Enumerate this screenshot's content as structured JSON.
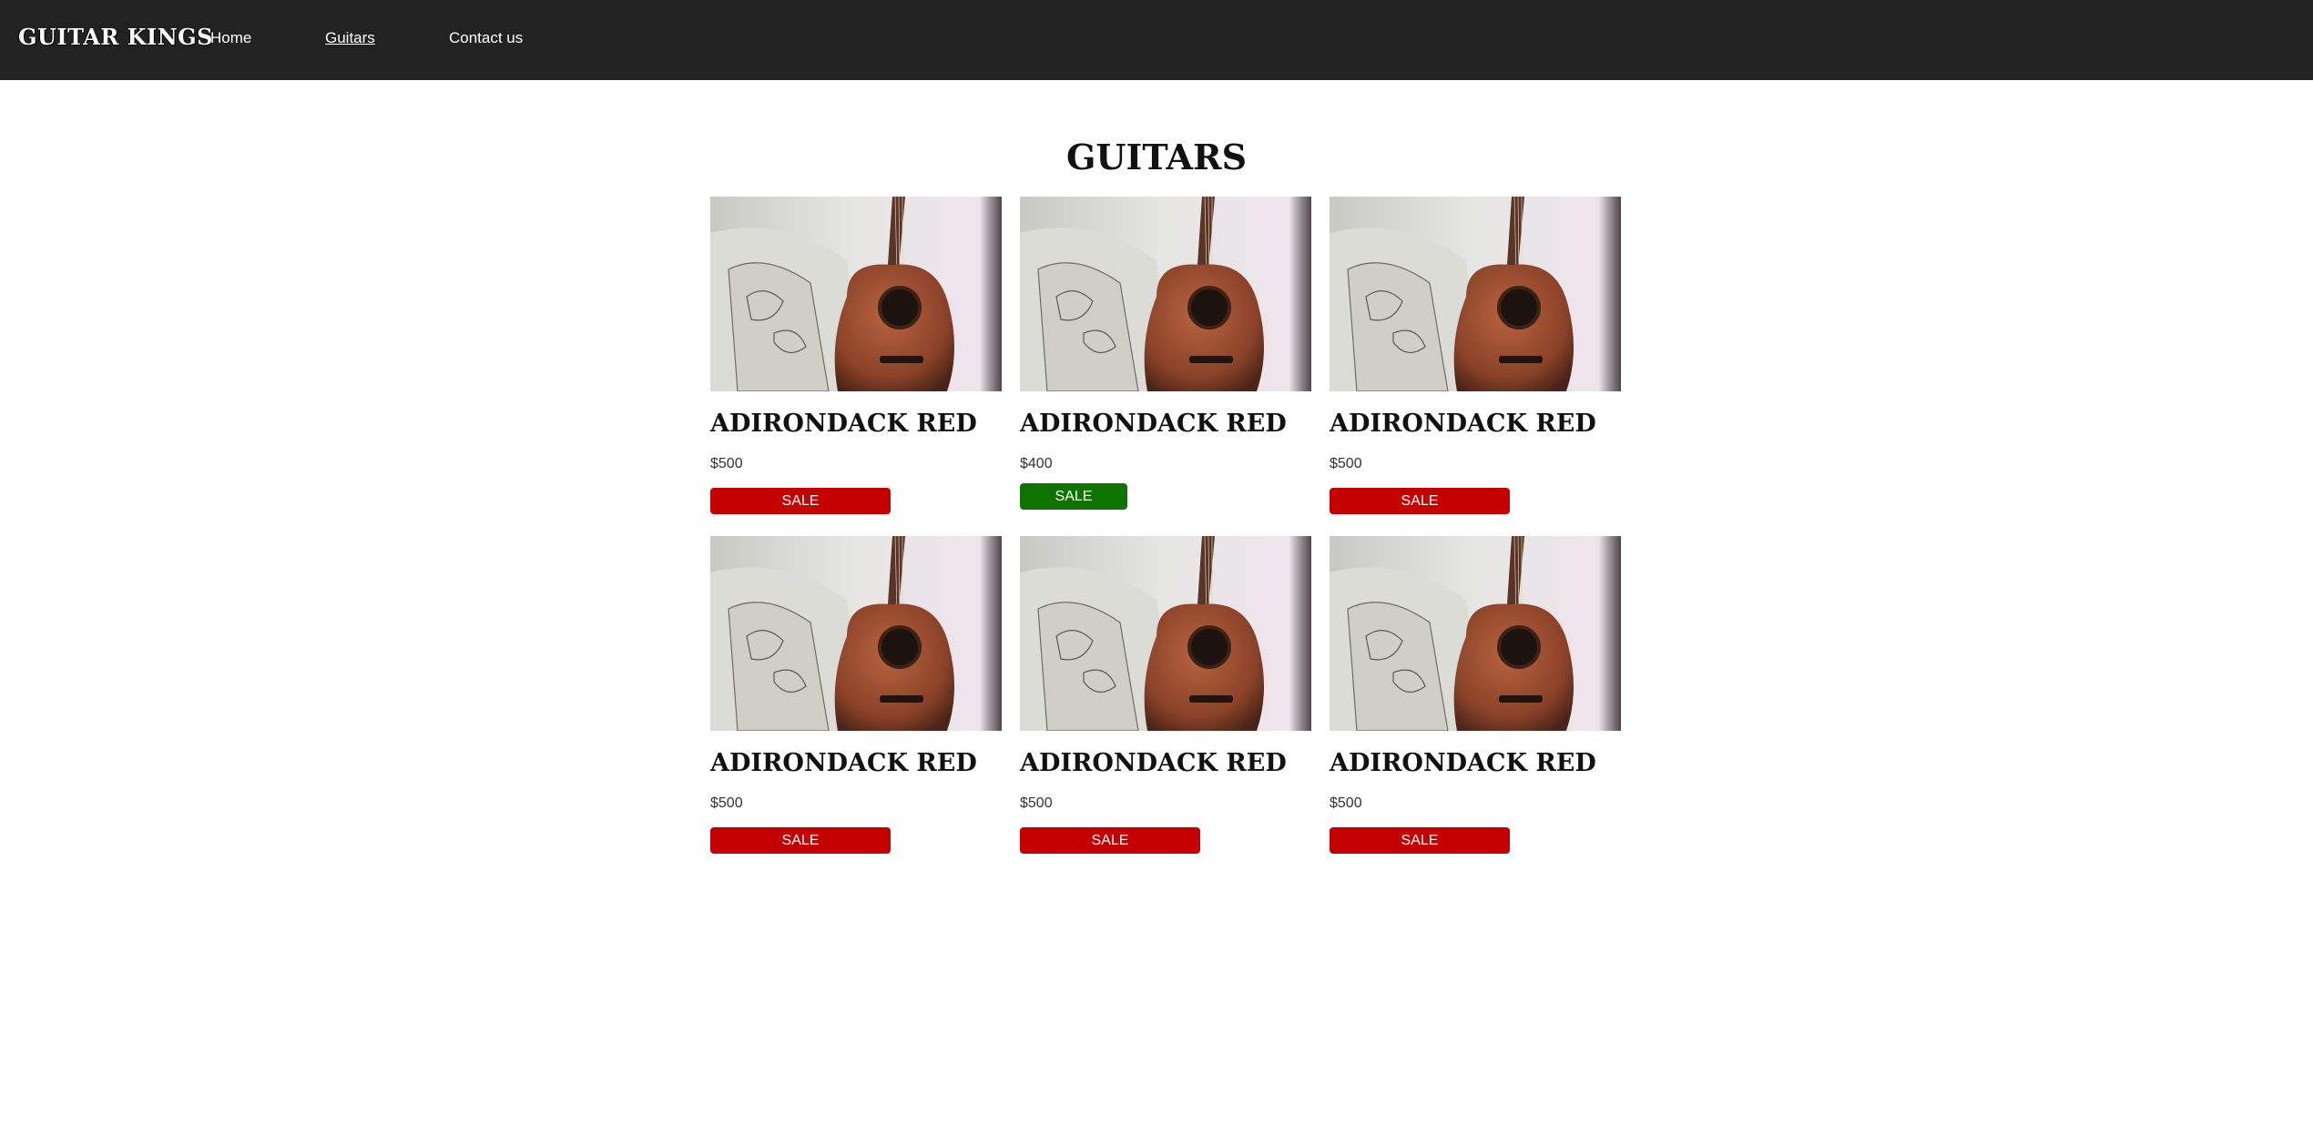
{
  "navbar": {
    "logo": "GUITAR KINGS",
    "links": [
      "Home",
      "Guitars",
      "Contact us"
    ],
    "active_link": "Guitars"
  },
  "page": {
    "title": "GUITARS"
  },
  "colors": {
    "navbar_bg": "#222222",
    "sale_red": "#c50000",
    "sale_green": "#0f7300"
  },
  "products": [
    {
      "name": "ADIRONDACK RED",
      "price": "$500",
      "button_label": "SALE",
      "button_color": "red",
      "image": "acoustic-guitar-photo"
    },
    {
      "name": "ADIRONDACK RED",
      "price": "$400",
      "button_label": "SALE",
      "button_color": "green",
      "image": "acoustic-guitar-photo"
    },
    {
      "name": "ADIRONDACK RED",
      "price": "$500",
      "button_label": "SALE",
      "button_color": "red",
      "image": "acoustic-guitar-photo"
    },
    {
      "name": "ADIRONDACK RED",
      "price": "$500",
      "button_label": "SALE",
      "button_color": "red",
      "image": "acoustic-guitar-photo"
    },
    {
      "name": "ADIRONDACK RED",
      "price": "$500",
      "button_label": "SALE",
      "button_color": "red",
      "image": "acoustic-guitar-photo"
    },
    {
      "name": "ADIRONDACK RED",
      "price": "$500",
      "button_label": "SALE",
      "button_color": "red",
      "image": "acoustic-guitar-photo"
    }
  ]
}
